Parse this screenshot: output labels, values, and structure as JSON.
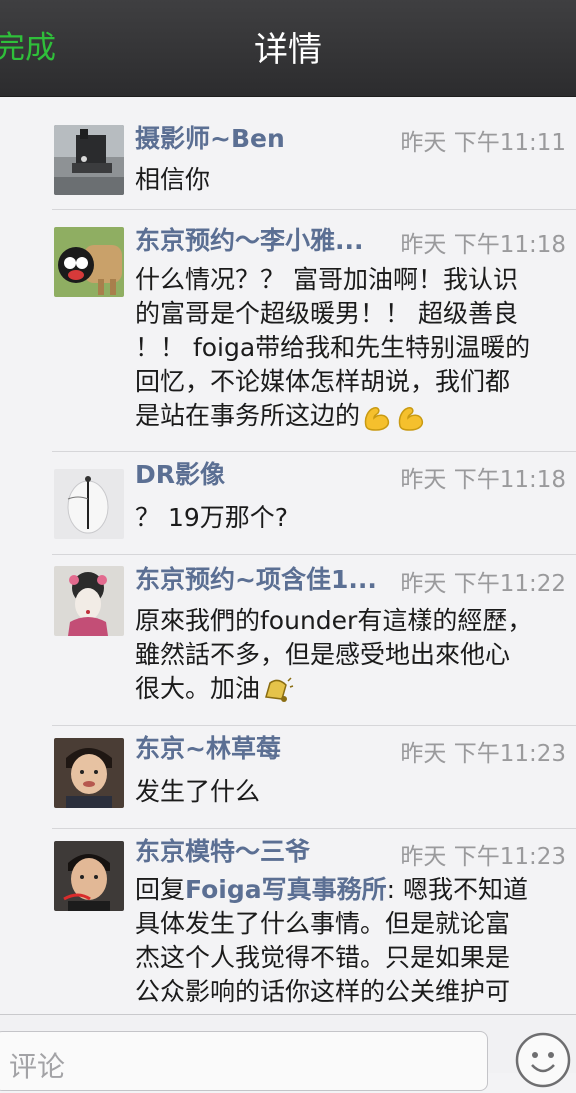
{
  "header": {
    "done_label": "完成",
    "title": "详情"
  },
  "comments": [
    {
      "name": "摄影师~Ben",
      "time": "昨天 下午11:11",
      "text": "相信你",
      "avatar": "train-avatar"
    },
    {
      "name": "东京预约～李小雅...",
      "time": "昨天 下午11:18",
      "lines": [
        "什么情况？？ 富哥加油啊！我认识",
        "的富哥是个超级暖男！！ 超级善良",
        "！！ foiga带给我和先生特别温暖的",
        "回忆，不论媒体怎样胡说，我们都",
        "是站在事务所这边的"
      ],
      "emojis": [
        "flexed-biceps-icon",
        "flexed-biceps-icon"
      ],
      "avatar": "cartoon-avatar"
    },
    {
      "name": "DR影像",
      "time": "昨天 下午11:18",
      "text": "？ 19万那个?",
      "avatar": "mask-avatar"
    },
    {
      "name": "东京预约~项含佳1...",
      "time": "昨天 下午11:22",
      "lines": [
        "原來我們的founder有這樣的經歷，",
        "雖然話不多，但是感受地出來他心",
        "很大。加油"
      ],
      "emojis": [
        "bell-icon"
      ],
      "avatar": "geisha-avatar"
    },
    {
      "name": "东京~林草莓",
      "time": "昨天 下午11:23",
      "text": "发生了什么",
      "avatar": "boy-avatar"
    },
    {
      "name": "东京模特～三爷",
      "time": "昨天 下午11:23",
      "reply_prefix": "回复",
      "reply_to": "Foiga写真事務所",
      "lines": [
        "嗯我不知道",
        "具体发生了什么事情。但是就论富",
        "杰这个人我觉得不错。只是如果是",
        "公众影响的话你这样的公关维护可"
      ],
      "avatar": "man-avatar"
    }
  ],
  "input": {
    "placeholder": "评论"
  },
  "colors": {
    "nav_bg": "#333335",
    "done_green": "#2fbf3a",
    "name_blue": "#5b6f93",
    "time_gray": "#9a9a9c"
  }
}
